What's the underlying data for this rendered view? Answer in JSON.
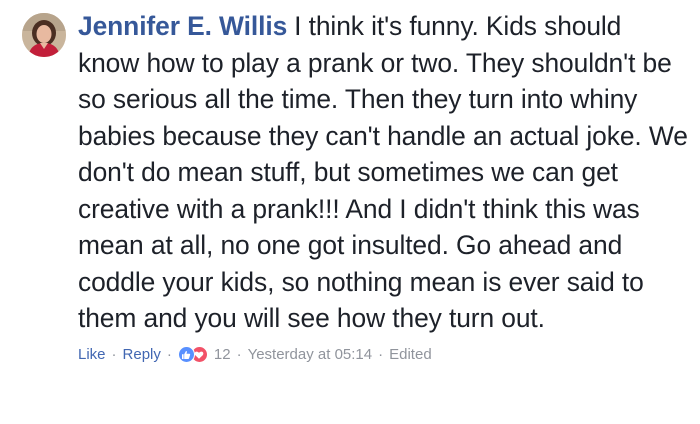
{
  "comment": {
    "author": "Jennifer E. Willis",
    "text": "I think it's funny. Kids should know how to play a prank or two. They shouldn't be so serious all the time. Then they turn into whiny babies because they can't handle an actual joke. We don't do mean stuff, but sometimes we can get creative with a prank!!! And I didn't think this was mean at all, no one got insulted. Go ahead and coddle your kids, so nothing mean is ever said to them and you will see how they turn out."
  },
  "actions": {
    "like_label": "Like",
    "reply_label": "Reply",
    "separator": "·",
    "reaction_count": "12",
    "timestamp": "Yesterday at 05:14",
    "edited_label": "Edited"
  },
  "reactions": [
    {
      "icon": "like-reaction-icon",
      "color": "#5890ff"
    },
    {
      "icon": "love-reaction-icon",
      "color": "#f25268"
    }
  ],
  "colors": {
    "author_name": "#365899",
    "link": "#4267b2",
    "meta": "#90949c",
    "text": "#1d2129"
  }
}
